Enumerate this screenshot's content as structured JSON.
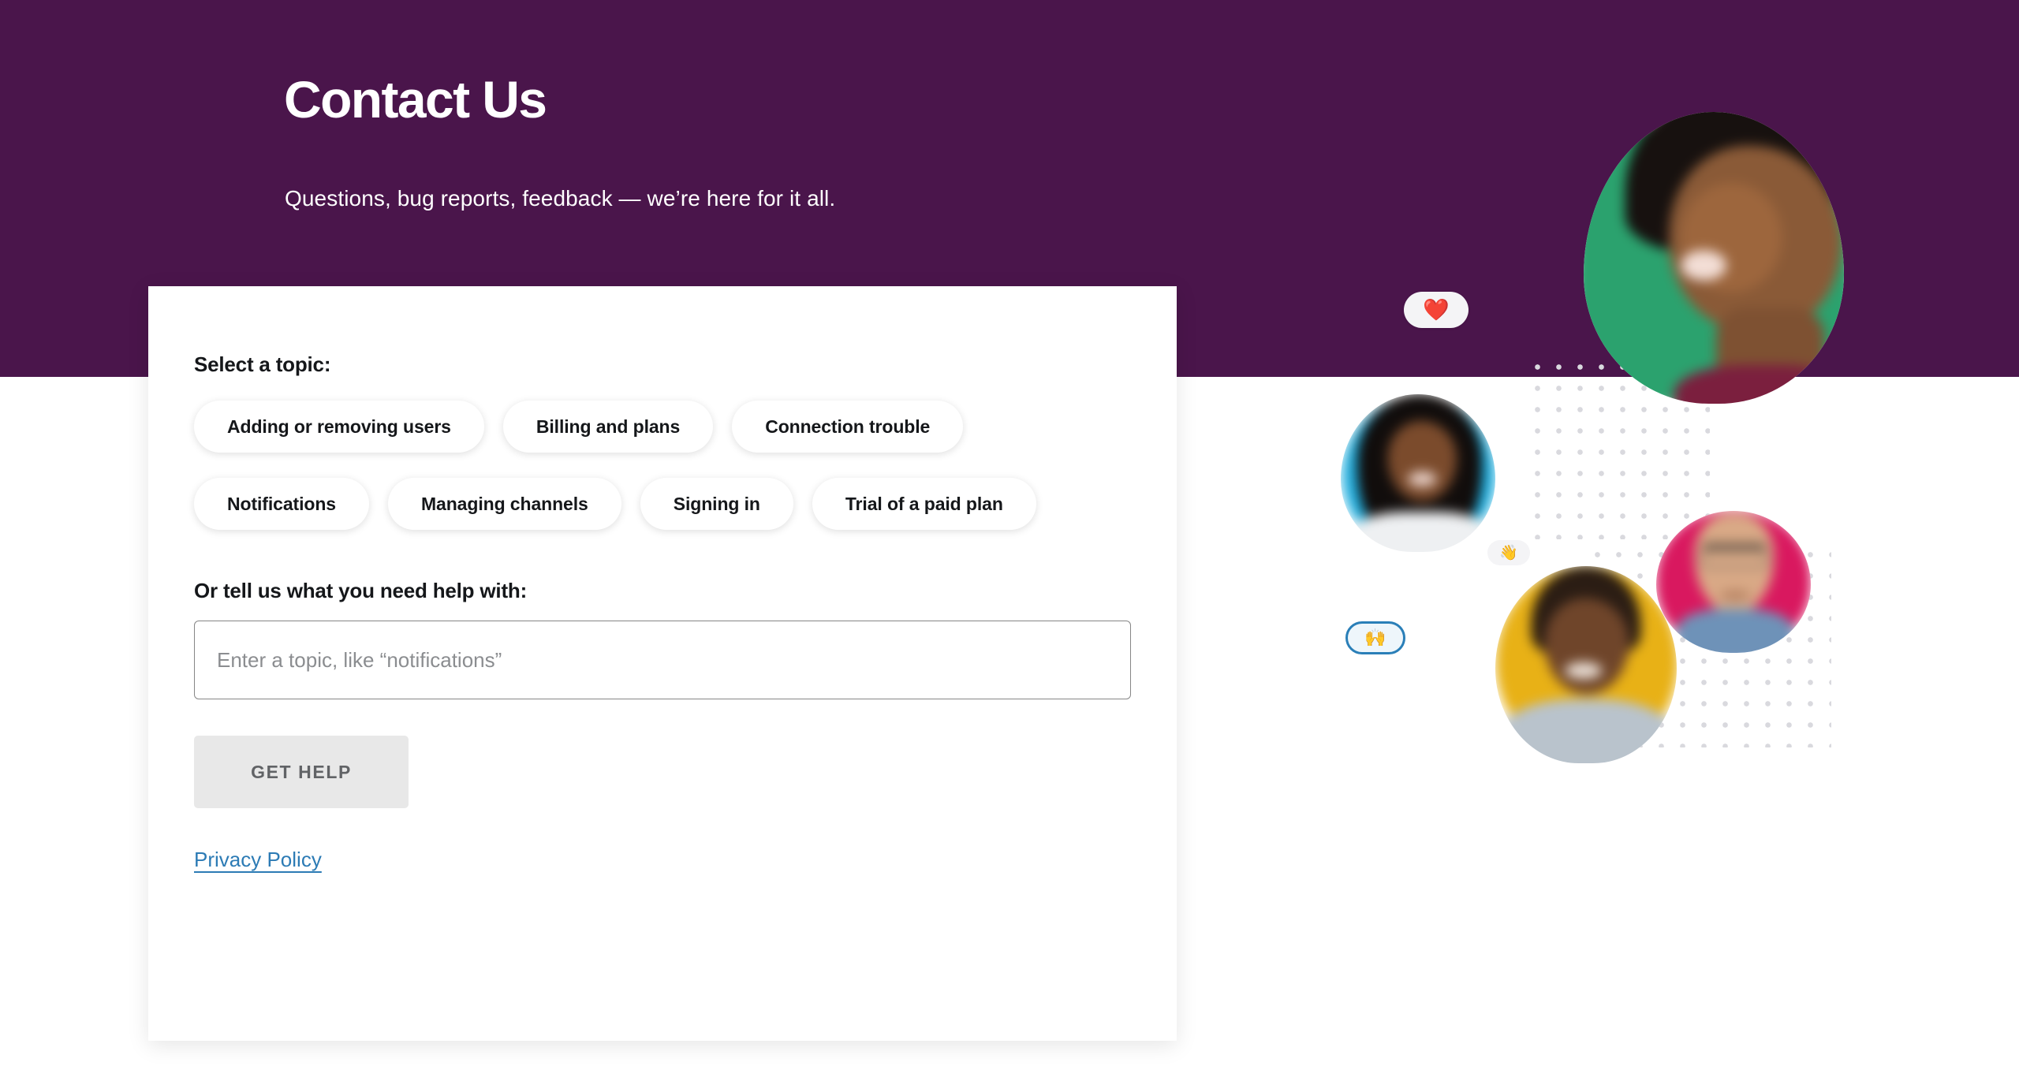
{
  "hero": {
    "title": "Contact Us",
    "subtitle": "Questions, bug reports, feedback — we’re here for it all.",
    "background_color": "#4A154B"
  },
  "form": {
    "topic_label": "Select a topic:",
    "topics": [
      "Adding or removing users",
      "Billing and plans",
      "Connection trouble",
      "Notifications",
      "Managing channels",
      "Signing in",
      "Trial of a paid plan"
    ],
    "free_text_label": "Or tell us what you need help with:",
    "input_placeholder": "Enter a topic, like “notifications”",
    "input_value": "",
    "submit_label": "GET HELP",
    "privacy_link": "Privacy Policy"
  },
  "illustration": {
    "emoji_heart": "❤️",
    "emoji_wave": "👋",
    "emoji_raising_hands": "🙌",
    "avatar_colors": {
      "green": "#2BA26E",
      "cyan": "#23B0E0",
      "magenta": "#D9185F",
      "yellow": "#E8B116"
    }
  },
  "colors": {
    "brand_purple": "#4A154B",
    "link_blue": "#2C7BB5",
    "button_gray": "#E8E8E8",
    "text_dark": "#15171A"
  }
}
